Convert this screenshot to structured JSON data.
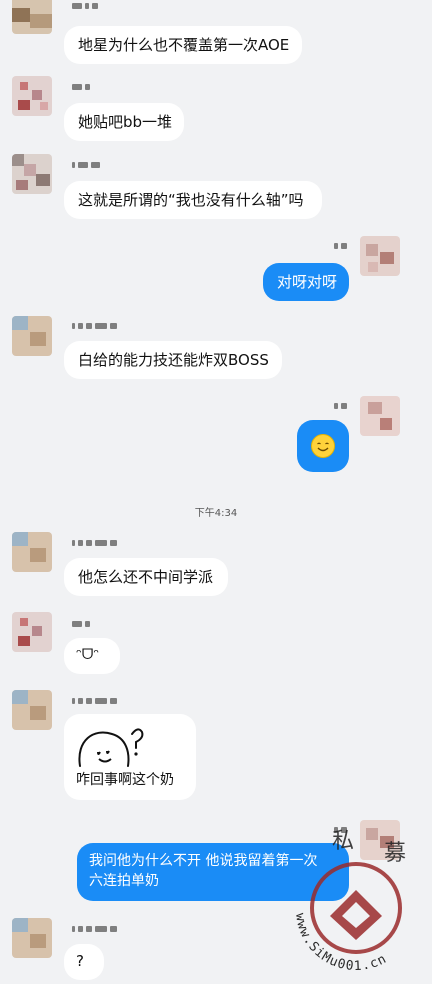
{
  "messages": [
    {
      "id": "m1",
      "text": "地星为什么也不覆盖第一次AOE"
    },
    {
      "id": "m2",
      "text": "她贴吧bb一堆"
    },
    {
      "id": "m3",
      "text": "这就是所谓的“我也没有什么轴”吗"
    },
    {
      "id": "m4",
      "text": "对呀对呀"
    },
    {
      "id": "m5",
      "text": "白给的能力技还能炸双BOSS"
    },
    {
      "id": "m6",
      "emoji": "smiling-emoji"
    },
    {
      "id": "m7",
      "text": "他怎么还不中间学派"
    },
    {
      "id": "m8",
      "text": "ᵔᗜᵔ"
    },
    {
      "id": "m9",
      "text": "咋回事啊这个奶",
      "sticker": "doodle-question-sticker"
    },
    {
      "id": "m10",
      "line1": "我问他为什么不开 他说我留着第一次",
      "line2": "六连拍单奶"
    },
    {
      "id": "m11",
      "text": "?"
    }
  ],
  "timestamp": "下午4:34",
  "watermark": {
    "site": "www.SiMu001.cn",
    "chars": [
      "私",
      "募"
    ]
  },
  "colors": {
    "background": "#f1f2f4",
    "outgoing": "#1a8cf6",
    "incoming": "#ffffff",
    "watermark": "#9a2a2a"
  }
}
